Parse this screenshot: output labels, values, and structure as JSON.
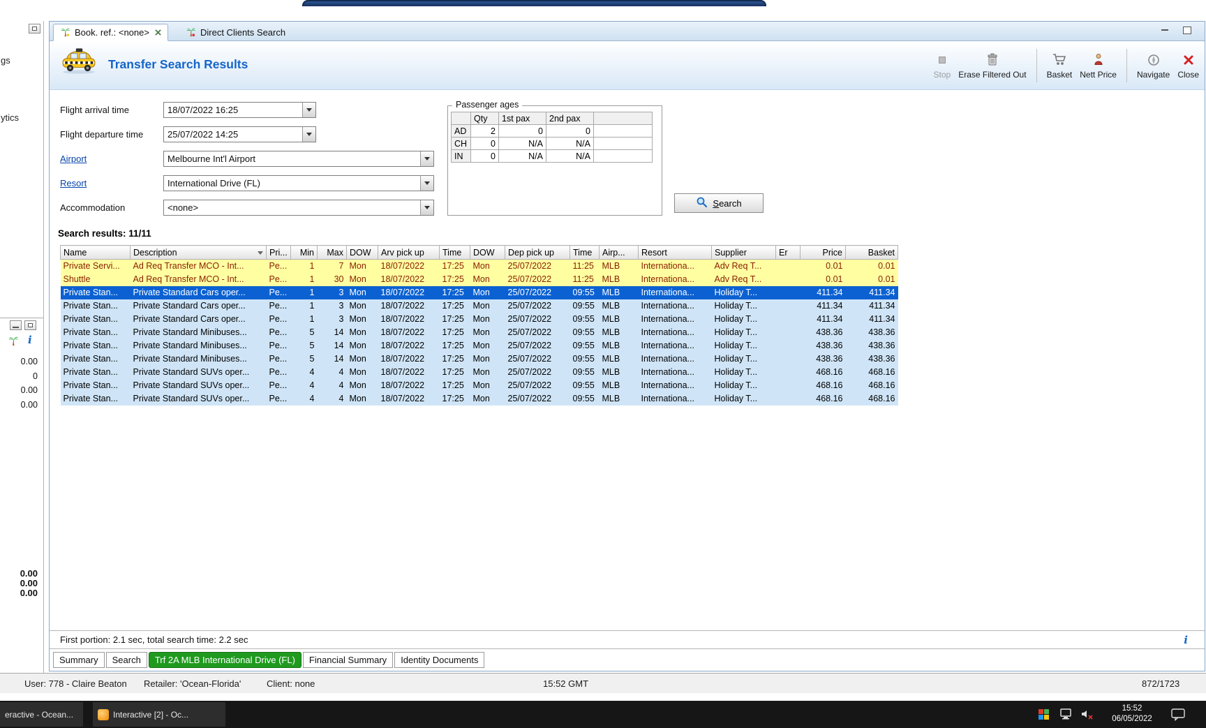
{
  "app": {
    "tabs": [
      {
        "label": "Book. ref.: <none>"
      },
      {
        "label": "Direct Clients Search"
      }
    ],
    "title": "Transfer Search Results",
    "toolbar": {
      "stop": "Stop",
      "erase": "Erase Filtered Out",
      "basket": "Basket",
      "nett_price": "Nett Price",
      "navigate": "Navigate",
      "close": "Close"
    }
  },
  "form": {
    "arrival": {
      "label": "Flight arrival time",
      "value": "18/07/2022 16:25"
    },
    "departure": {
      "label": "Flight departure time",
      "value": "25/07/2022 14:25"
    },
    "airport": {
      "label": "Airport",
      "value": "Melbourne Int'l Airport"
    },
    "resort": {
      "label": "Resort",
      "value": "International Drive (FL)"
    },
    "accommodation": {
      "label": "Accommodation",
      "value": "<none>"
    },
    "passenger_ages": {
      "title": "Passenger ages",
      "columns": [
        "Qty",
        "1st pax",
        "2nd pax"
      ],
      "rows": [
        {
          "label": "AD",
          "qty": "2",
          "pax1": "0",
          "pax2": "0"
        },
        {
          "label": "CH",
          "qty": "0",
          "pax1": "N/A",
          "pax2": "N/A"
        },
        {
          "label": "IN",
          "qty": "0",
          "pax1": "N/A",
          "pax2": "N/A"
        }
      ]
    },
    "search_label": "Search"
  },
  "results": {
    "summary": "Search results: 11/11",
    "columns": [
      "Name",
      "Description",
      "Pri...",
      "Min",
      "Max",
      "DOW",
      "Arv pick up",
      "Time",
      "DOW",
      "Dep pick up",
      "Time",
      "Airp...",
      "Resort",
      "Supplier",
      "Er",
      "Price",
      "Basket"
    ],
    "rows": [
      {
        "style": "yellow",
        "cells": [
          "Private Servi...",
          "Ad Req Transfer MCO - Int...",
          "Pe...",
          "1",
          "7",
          "Mon",
          "18/07/2022",
          "17:25",
          "Mon",
          "25/07/2022",
          "11:25",
          "MLB",
          "Internationa...",
          "Adv Req T...",
          "",
          "0.01",
          "0.01"
        ]
      },
      {
        "style": "yellow",
        "cells": [
          "Shuttle",
          "Ad Req Transfer MCO - Int...",
          "Pe...",
          "1",
          "30",
          "Mon",
          "18/07/2022",
          "17:25",
          "Mon",
          "25/07/2022",
          "11:25",
          "MLB",
          "Internationa...",
          "Adv Req T...",
          "",
          "0.01",
          "0.01"
        ]
      },
      {
        "style": "selected",
        "cells": [
          "Private Stan...",
          "Private Standard Cars oper...",
          "Pe...",
          "1",
          "3",
          "Mon",
          "18/07/2022",
          "17:25",
          "Mon",
          "25/07/2022",
          "09:55",
          "MLB",
          "Internationa...",
          "Holiday T...",
          "",
          "411.34",
          "411.34"
        ]
      },
      {
        "style": "blue",
        "cells": [
          "Private Stan...",
          "Private Standard Cars oper...",
          "Pe...",
          "1",
          "3",
          "Mon",
          "18/07/2022",
          "17:25",
          "Mon",
          "25/07/2022",
          "09:55",
          "MLB",
          "Internationa...",
          "Holiday T...",
          "",
          "411.34",
          "411.34"
        ]
      },
      {
        "style": "blue",
        "cells": [
          "Private Stan...",
          "Private Standard Cars oper...",
          "Pe...",
          "1",
          "3",
          "Mon",
          "18/07/2022",
          "17:25",
          "Mon",
          "25/07/2022",
          "09:55",
          "MLB",
          "Internationa...",
          "Holiday T...",
          "",
          "411.34",
          "411.34"
        ]
      },
      {
        "style": "blue",
        "cells": [
          "Private Stan...",
          "Private Standard Minibuses...",
          "Pe...",
          "5",
          "14",
          "Mon",
          "18/07/2022",
          "17:25",
          "Mon",
          "25/07/2022",
          "09:55",
          "MLB",
          "Internationa...",
          "Holiday T...",
          "",
          "438.36",
          "438.36"
        ]
      },
      {
        "style": "blue",
        "cells": [
          "Private Stan...",
          "Private Standard Minibuses...",
          "Pe...",
          "5",
          "14",
          "Mon",
          "18/07/2022",
          "17:25",
          "Mon",
          "25/07/2022",
          "09:55",
          "MLB",
          "Internationa...",
          "Holiday T...",
          "",
          "438.36",
          "438.36"
        ]
      },
      {
        "style": "blue",
        "cells": [
          "Private Stan...",
          "Private Standard Minibuses...",
          "Pe...",
          "5",
          "14",
          "Mon",
          "18/07/2022",
          "17:25",
          "Mon",
          "25/07/2022",
          "09:55",
          "MLB",
          "Internationa...",
          "Holiday T...",
          "",
          "438.36",
          "438.36"
        ]
      },
      {
        "style": "blue",
        "cells": [
          "Private Stan...",
          "Private Standard SUVs oper...",
          "Pe...",
          "4",
          "4",
          "Mon",
          "18/07/2022",
          "17:25",
          "Mon",
          "25/07/2022",
          "09:55",
          "MLB",
          "Internationa...",
          "Holiday T...",
          "",
          "468.16",
          "468.16"
        ]
      },
      {
        "style": "blue",
        "cells": [
          "Private Stan...",
          "Private Standard SUVs oper...",
          "Pe...",
          "4",
          "4",
          "Mon",
          "18/07/2022",
          "17:25",
          "Mon",
          "25/07/2022",
          "09:55",
          "MLB",
          "Internationa...",
          "Holiday T...",
          "",
          "468.16",
          "468.16"
        ]
      },
      {
        "style": "blue",
        "cells": [
          "Private Stan...",
          "Private Standard SUVs oper...",
          "Pe...",
          "4",
          "4",
          "Mon",
          "18/07/2022",
          "17:25",
          "Mon",
          "25/07/2022",
          "09:55",
          "MLB",
          "Internationa...",
          "Holiday T...",
          "",
          "468.16",
          "468.16"
        ]
      }
    ],
    "timing": "First portion: 2.1 sec, total search time: 2.2 sec",
    "info_icon": "i"
  },
  "bottom_tabs": {
    "summary": "Summary",
    "search": "Search",
    "active": "Trf 2A MLB International Drive (FL)",
    "financial": "Financial Summary",
    "identity": "Identity Documents"
  },
  "statusbar": {
    "user": "User: 778 - Claire Beaton",
    "retailer": "Retailer: 'Ocean-Florida'",
    "client": "Client: none",
    "time": "15:52 GMT",
    "pages": "872/1723"
  },
  "left_panel": {
    "fragments": [
      "gs",
      "ytics"
    ],
    "values": [
      "0.00",
      "0",
      "0.00",
      "0.00"
    ],
    "totals": [
      "0.00",
      "0.00",
      "0.00"
    ],
    "info_icon": "i"
  },
  "taskbar": {
    "item1": "eractive - Ocean...",
    "item2": "Interactive [2] - Oc...",
    "time": "15:52",
    "date": "06/05/2022"
  }
}
